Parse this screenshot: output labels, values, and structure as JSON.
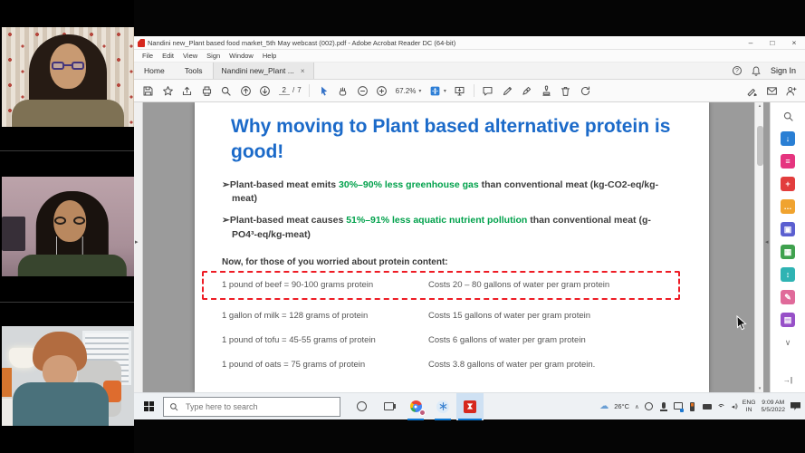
{
  "window": {
    "title": "Nandini new_Plant based food market_5th May webcast (002).pdf - Adobe Acrobat Reader DC (64-bit)",
    "controls": {
      "minimize": "–",
      "maximize": "□",
      "close": "×"
    },
    "menu": [
      "File",
      "Edit",
      "View",
      "Sign",
      "Window",
      "Help"
    ],
    "tabs": {
      "home": "Home",
      "tools": "Tools",
      "document": "Nandini new_Plant ...",
      "document_close": "×",
      "help": "?",
      "sign_in": "Sign In"
    },
    "toolbar": {
      "page_current": "2",
      "page_separator": "/",
      "page_total": "7",
      "zoom_level": "67.2%"
    }
  },
  "slide": {
    "title": "Why moving to Plant based alternative protein is good!",
    "bullets": [
      {
        "marker": "➢",
        "pre": "Plant-based meat emits ",
        "highlight": "30%–90% less greenhouse gas",
        "post": " than conventional meat (kg-CO2-eq/kg-meat)"
      },
      {
        "marker": "➢",
        "pre": "Plant-based meat causes ",
        "highlight": "51%–91% less aquatic nutrient pollution",
        "post": " than conventional meat (g-PO4³-eq/kg-meat)"
      }
    ],
    "subheading": "Now, for those of you worried about protein content:",
    "protein_rows": [
      {
        "item": "1 pound of beef = 90-100 grams protein",
        "cost": "Costs 20 – 80 gallons of water per gram protein"
      },
      {
        "item": "1 gallon of milk = 128 grams of protein",
        "cost": "Costs 15 gallons of water per gram protein"
      },
      {
        "item": "1 pound of tofu = 45-55 grams of protein",
        "cost": "Costs 6 gallons of water per gram protein"
      },
      {
        "item": "1 pound of oats = 75 grams of protein",
        "cost": "Costs 3.8 gallons of water per gram protein."
      }
    ]
  },
  "taskbar": {
    "search_placeholder": "Type here to search",
    "tray": {
      "temperature": "26°C",
      "language_line1": "ENG",
      "language_line2": "IN",
      "time": "9:09 AM",
      "date": "5/5/2022"
    }
  },
  "icons": {
    "caret_down": "▾",
    "scroll_up": "▴",
    "scroll_down": "▾",
    "panel_expand_left": "▸",
    "panel_expand_right": "◂",
    "tray_chevron_up": "∧",
    "panel_chevron": "∨",
    "panel_collapse": "→|",
    "cloud": "☁",
    "export_glyph": "↓",
    "edit_glyph": "≡",
    "create_glyph": "+",
    "comment_glyph": "…",
    "combine_glyph": "▣",
    "organize_glyph": "▦",
    "compress_glyph": "↕",
    "fillsign_glyph": "✎",
    "scan_glyph": "▤"
  },
  "colors": {
    "slide_title_blue": "#1b6ac9",
    "highlight_green": "#00a14b",
    "dashed_box_red": "#ee1c25",
    "acrobat_red": "#d6281e",
    "taskbar_indicator_blue": "#0b76d1"
  }
}
